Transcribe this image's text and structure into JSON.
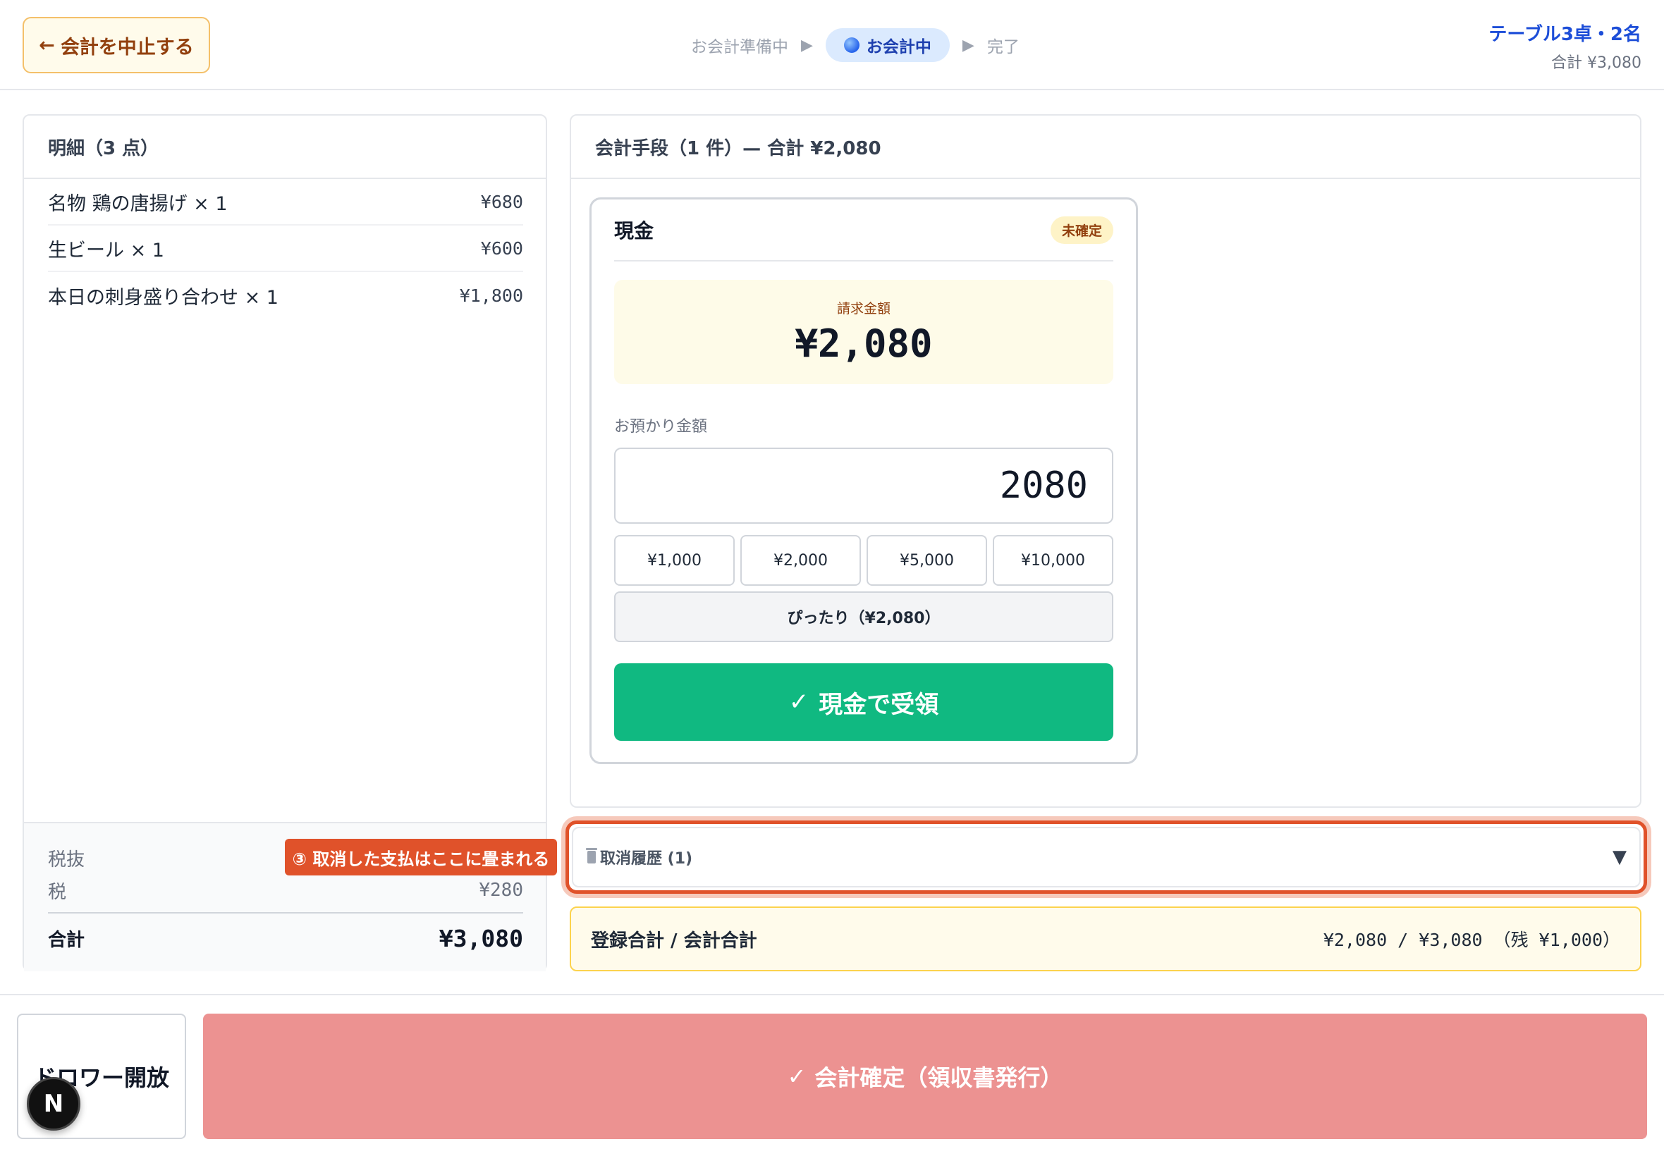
{
  "header": {
    "cancel_label": "会計を中止する",
    "cancel_arrow": "←",
    "steps": {
      "prep": "お会計準備中",
      "active": "お会計中",
      "done": "完了",
      "arrow": "▶"
    },
    "table_name": "テーブル3卓・2名",
    "table_total": "合計 ¥3,080"
  },
  "order": {
    "title": "明細（3 点）",
    "items": [
      {
        "name": "名物 鶏の唐揚げ × 1",
        "price": "¥680"
      },
      {
        "name": "生ビール × 1",
        "price": "¥600"
      },
      {
        "name": "本日の刺身盛り合わせ × 1",
        "price": "¥1,800"
      }
    ],
    "subtotal_label": "税抜",
    "tax_label": "税",
    "tax_value": "¥280",
    "total_label": "合計",
    "total_value": "¥3,080"
  },
  "annotation": "③ 取消した支払はここに畳まれる",
  "payment": {
    "title": "会計手段（1 件）— 合計 ¥2,080",
    "card_title": "現金",
    "status_badge": "未確定",
    "billing_label": "請求金額",
    "billing_value": "¥2,080",
    "received_label": "お預かり金額",
    "received_value": "2080",
    "quick_amounts": [
      "¥1,000",
      "¥2,000",
      "¥5,000",
      "¥10,000"
    ],
    "exact_label": "ぴったり（¥2,080）",
    "receive_check": "✓",
    "receive_label": "現金で受領"
  },
  "history": {
    "label": "取消履歴 (1)",
    "chevron": "▼"
  },
  "totals": {
    "label": "登録合計 / 会計合計",
    "value": "¥2,080 / ¥3,080 （残 ¥1,000）"
  },
  "footer": {
    "drawer_label": "ドロワー開放",
    "confirm_check": "✓",
    "confirm_label": "会計確定（領収書発行）"
  },
  "dev_badge": "N",
  "colors": {
    "accent_green": "#10b981",
    "confirm_disabled": "#ec9291",
    "annotation": "#e0522a",
    "brand_blue": "#1d4ed8"
  }
}
